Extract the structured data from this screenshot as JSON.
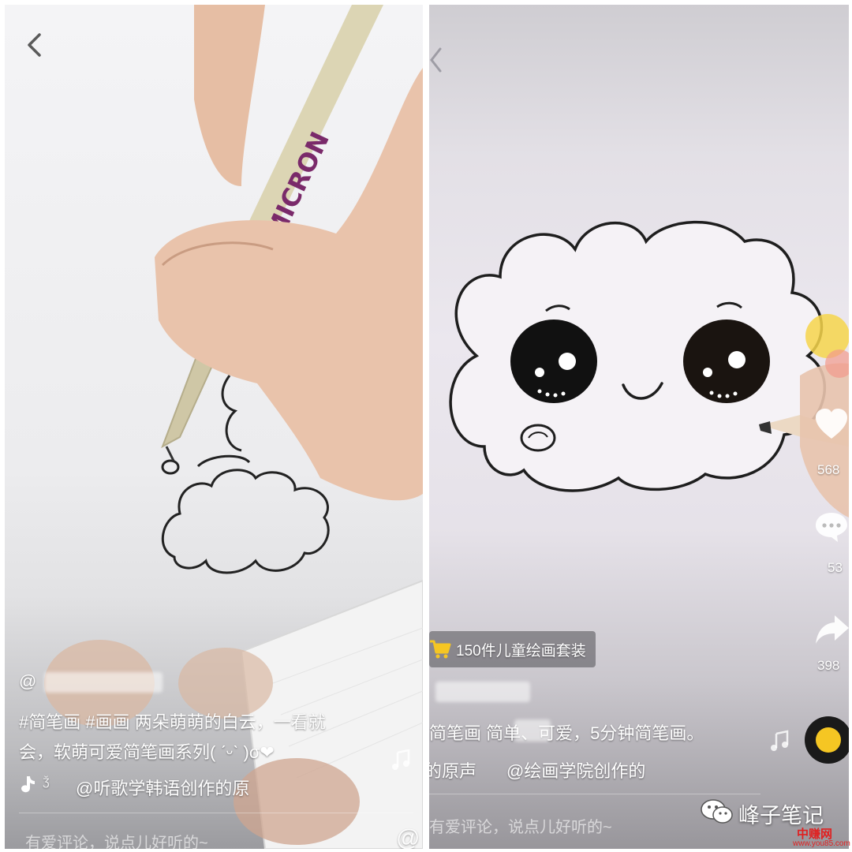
{
  "left": {
    "author": "@",
    "caption_line1": "#简笔画 #画画 两朵萌萌的白云，一看就",
    "caption_line2": "会，软萌可爱简笔画系列( ˊᵕˋ )σ❤",
    "music": "@听歌学韩语创作的原",
    "comment_placeholder": "有爱评论，说点儿好听的~",
    "mention_symbol": "@"
  },
  "right": {
    "product_label": "150件儿童绘画套装",
    "caption": "简笔画 简单、可爱，5分钟简笔画。",
    "music_prefix": "的原声",
    "music_author": "@绘画学院创作的",
    "like_count": "568",
    "comment_count": "53",
    "share_count": "398",
    "comment_placeholder": "有爱评论，说点儿好听的~"
  },
  "watermark": {
    "title": "峰子笔记",
    "brand": "中赚网",
    "url": "www.you85.com"
  },
  "colors": {
    "accent_yellow": "#f5c623",
    "brand_red": "#e02020"
  }
}
